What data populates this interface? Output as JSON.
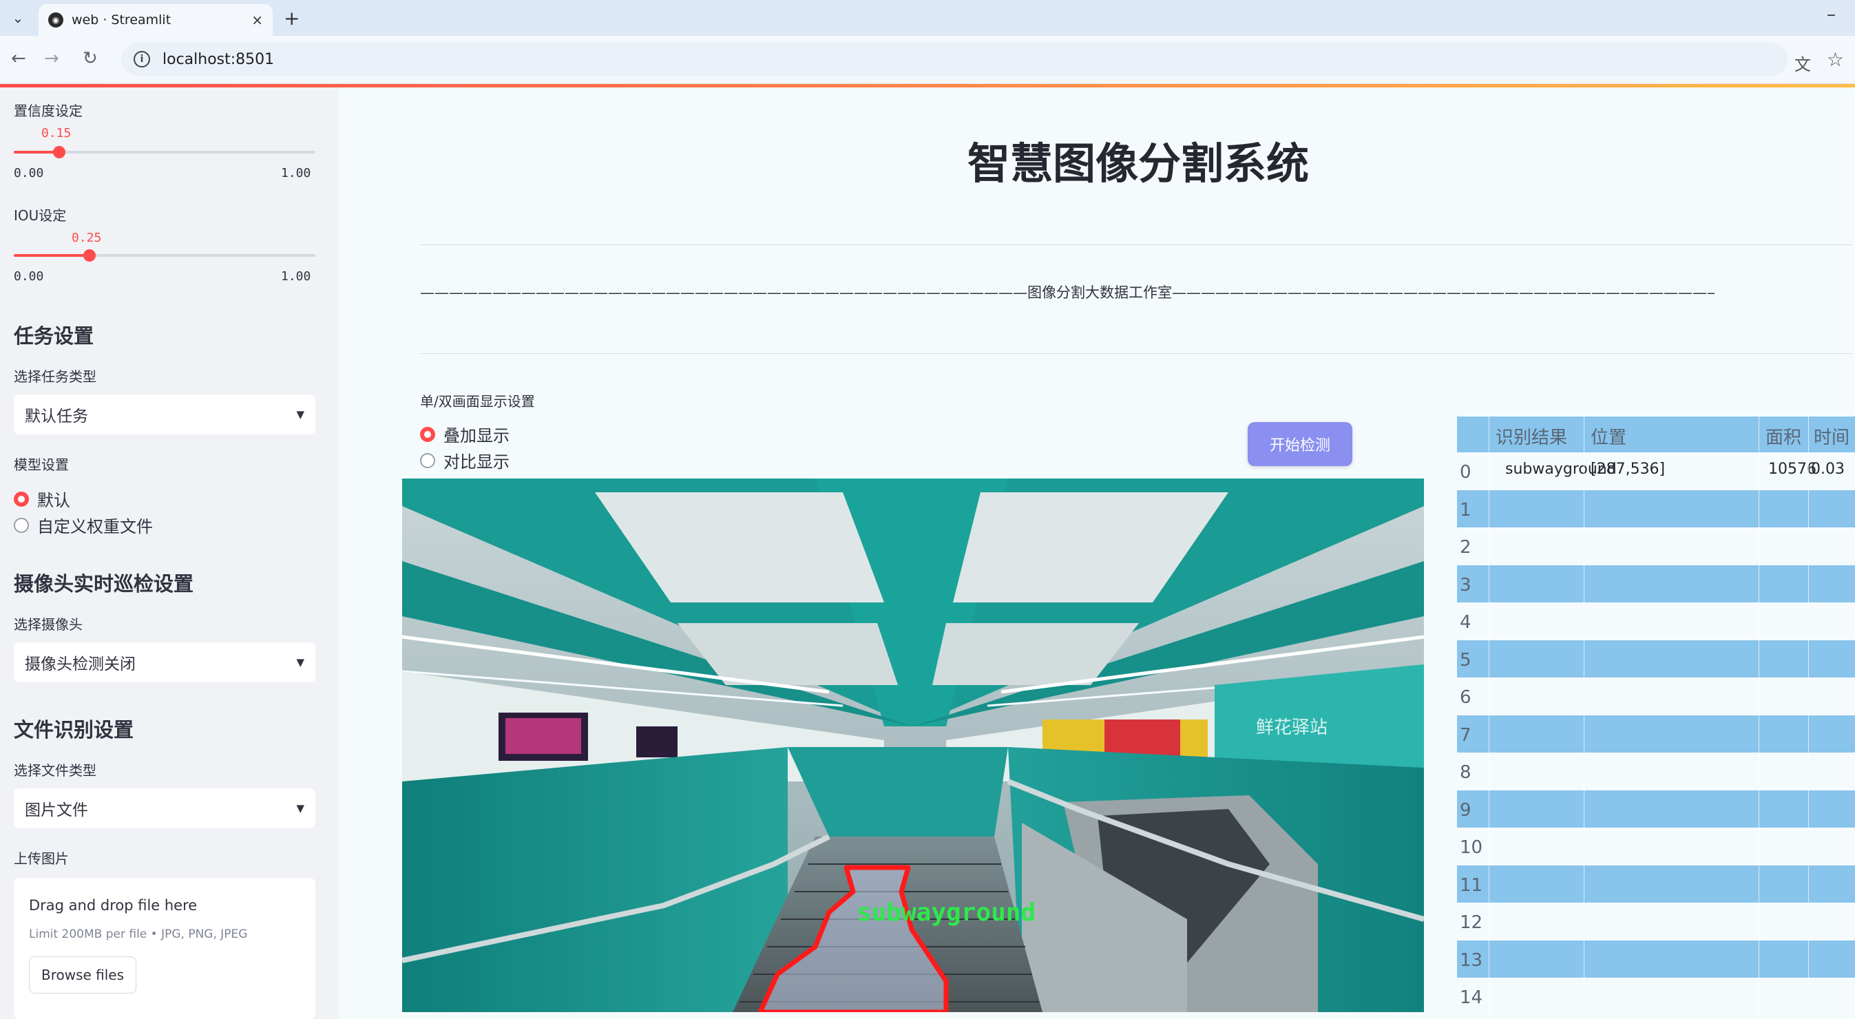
{
  "browser": {
    "tab_title": "web · Streamlit",
    "url": "localhost:8501",
    "new_tab": "+",
    "close": "×",
    "minimize": "–"
  },
  "sidebar": {
    "confidence": {
      "label": "置信度设定",
      "value": "0.15",
      "min": "0.00",
      "max": "1.00",
      "fraction": 0.15
    },
    "iou": {
      "label": "IOU设定",
      "value": "0.25",
      "min": "0.00",
      "max": "1.00",
      "fraction": 0.25
    },
    "task_section": "任务设置",
    "task_type_label": "选择任务类型",
    "task_type_value": "默认任务",
    "model_label": "模型设置",
    "model_options": [
      "默认",
      "自定义权重文件"
    ],
    "camera_section": "摄像头实时巡检设置",
    "camera_label": "选择摄像头",
    "camera_value": "摄像头检测关闭",
    "file_section": "文件识别设置",
    "file_type_label": "选择文件类型",
    "file_type_value": "图片文件",
    "upload_label": "上传图片",
    "upload_title": "Drag and drop file here",
    "upload_limit": "Limit 200MB per file • JPG, PNG, JPEG",
    "browse_button": "Browse files"
  },
  "main": {
    "title": "智慧图像分割系统",
    "divider_text": "——————————————————————————————————————————图像分割大数据工作室————————————————————————————————————————————",
    "display_mode_label": "单/双画面显示设置",
    "display_modes": [
      "叠加显示",
      "对比显示"
    ],
    "start_button": "开始检测",
    "overlay_label": "subwayground",
    "station_sign": "鲜花驿站"
  },
  "table": {
    "columns": [
      "识别结果",
      "位置",
      "面积",
      "时间"
    ],
    "rows": [
      {
        "index": "0",
        "result": "subwayground",
        "position": "[287,536]",
        "area": "10576",
        "time": "0.03"
      },
      {
        "index": "1"
      },
      {
        "index": "2"
      },
      {
        "index": "3"
      },
      {
        "index": "4"
      },
      {
        "index": "5"
      },
      {
        "index": "6"
      },
      {
        "index": "7"
      },
      {
        "index": "8"
      },
      {
        "index": "9"
      },
      {
        "index": "10"
      },
      {
        "index": "11"
      },
      {
        "index": "12"
      },
      {
        "index": "13"
      },
      {
        "index": "14"
      }
    ]
  },
  "colors": {
    "accent": "#ff4b4b",
    "button": "#8a8ff0",
    "table_stripe": "#88c4ec",
    "mask": "#ff1a1a",
    "label": "#2ee84a"
  }
}
